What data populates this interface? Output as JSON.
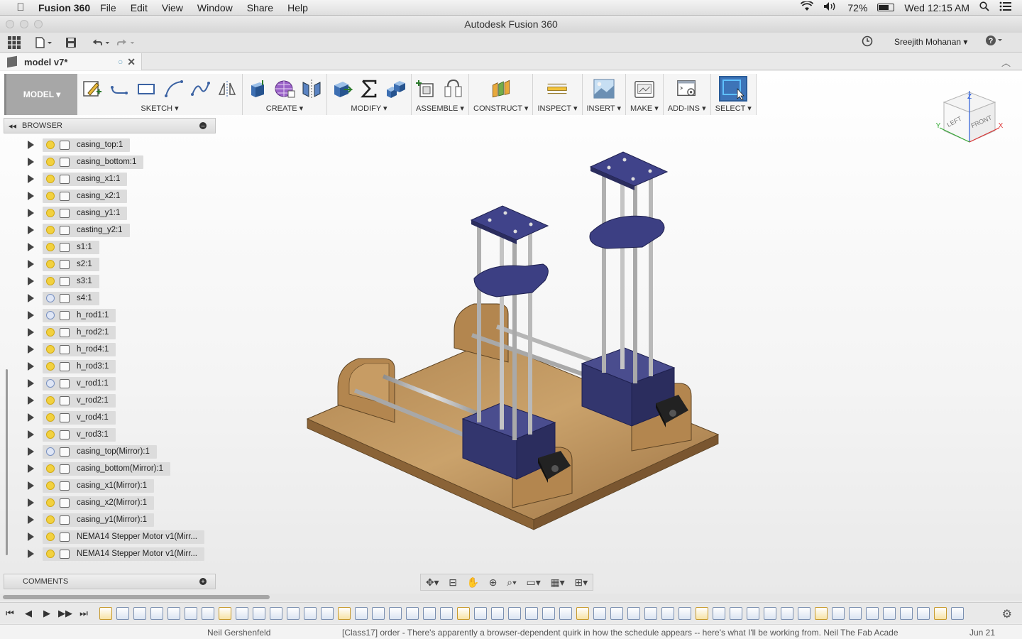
{
  "menubar": {
    "app_name": "Fusion 360",
    "menus": [
      "File",
      "Edit",
      "View",
      "Window",
      "Share",
      "Help"
    ],
    "battery": "72%",
    "battery_level": 0.72,
    "clock": "Wed 12:15 AM"
  },
  "window": {
    "title": "Autodesk Fusion 360"
  },
  "quickbar": {
    "user": "Sreejith Mohanan ▾"
  },
  "document": {
    "tab_title": "model v7*"
  },
  "toolbar": {
    "workspace": "MODEL ▾",
    "groups": [
      {
        "label": "SKETCH ▾"
      },
      {
        "label": "CREATE ▾"
      },
      {
        "label": "MODIFY ▾"
      },
      {
        "label": "ASSEMBLE ▾"
      },
      {
        "label": "CONSTRUCT ▾"
      },
      {
        "label": "INSPECT ▾"
      },
      {
        "label": "INSERT ▾"
      },
      {
        "label": "MAKE ▾"
      },
      {
        "label": "ADD-INS ▾"
      },
      {
        "label": "SELECT ▾"
      }
    ]
  },
  "browser": {
    "title": "BROWSER",
    "items": [
      {
        "label": "casing_top:1",
        "visible": true
      },
      {
        "label": "casing_bottom:1",
        "visible": true
      },
      {
        "label": "casing_x1:1",
        "visible": true
      },
      {
        "label": "casing_x2:1",
        "visible": true
      },
      {
        "label": "casing_y1:1",
        "visible": true
      },
      {
        "label": "casting_y2:1",
        "visible": true
      },
      {
        "label": "s1:1",
        "visible": true
      },
      {
        "label": "s2:1",
        "visible": true
      },
      {
        "label": "s3:1",
        "visible": true
      },
      {
        "label": "s4:1",
        "visible": false
      },
      {
        "label": "h_rod1:1",
        "visible": false
      },
      {
        "label": "h_rod2:1",
        "visible": true
      },
      {
        "label": "h_rod4:1",
        "visible": true
      },
      {
        "label": "h_rod3:1",
        "visible": true
      },
      {
        "label": "v_rod1:1",
        "visible": false
      },
      {
        "label": "v_rod2:1",
        "visible": true
      },
      {
        "label": "v_rod4:1",
        "visible": true
      },
      {
        "label": "v_rod3:1",
        "visible": true
      },
      {
        "label": "casing_top(Mirror):1",
        "visible": false
      },
      {
        "label": "casing_bottom(Mirror):1",
        "visible": true
      },
      {
        "label": "casing_x1(Mirror):1",
        "visible": true
      },
      {
        "label": "casing_x2(Mirror):1",
        "visible": true
      },
      {
        "label": "casing_y1(Mirror):1",
        "visible": true
      },
      {
        "label": "NEMA14 Stepper Motor v1(Mirr...",
        "visible": true
      },
      {
        "label": "NEMA14 Stepper Motor v1(Mirr...",
        "visible": true
      }
    ]
  },
  "comments": {
    "title": "COMMENTS"
  },
  "viewcube": {
    "top": "Z",
    "left": "LEFT",
    "front": "FRONT",
    "x": "X",
    "y": "Y"
  },
  "colors": {
    "accent": "#3d74b8",
    "wood": "#c9a06a",
    "casing": "#383b78",
    "rod": "#b9b9b9"
  },
  "statusbar": {
    "sender": "Neil Gershenfeld",
    "subject": "[Class17] order - There's apparently a browser-dependent quirk in how the schedule appears -- here's what I'll be working from. Neil The Fab Acade",
    "date": "Jun 21"
  }
}
